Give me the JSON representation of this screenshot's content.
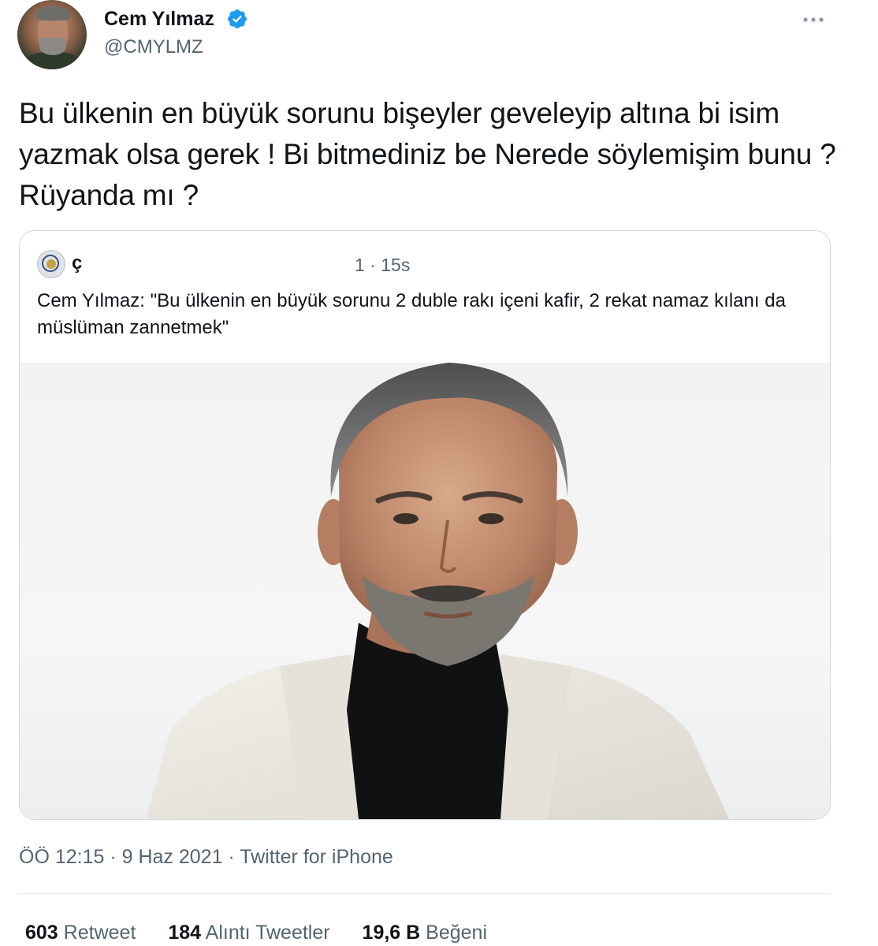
{
  "author": {
    "name": "Cem Yılmaz",
    "handle": "@CMYLMZ",
    "verified": true
  },
  "tweet": {
    "text": "Bu ülkenin en büyük sorunu bişeyler geveleyip altına bi isim yazmak olsa gerek ! Bi bitmediniz be Nerede söylemişim bunu ? Rüyanda mı ?"
  },
  "quoted_tweet": {
    "author_fragment": "ç",
    "time": "1 · 15s",
    "text": "Cem Yılmaz: \"Bu ülkenin en büyük sorunu 2 duble rakı içeni kafir, 2 rekat namaz kılanı da müslüman zannetmek\"",
    "image": "portrait-photo"
  },
  "meta": {
    "timestamp": "ÖÖ 12:15 · 9 Haz 2021 · Twitter for iPhone"
  },
  "stats": {
    "retweets_count": "603",
    "retweets_label": "Retweet",
    "quotes_count": "184",
    "quotes_label": "Alıntı Tweetler",
    "likes_count": "19,6 B",
    "likes_label": "Beğeni"
  },
  "icons": {
    "verified": "verified-badge-icon",
    "more": "more-options-icon"
  },
  "colors": {
    "text": "#0f1419",
    "secondary": "#536471",
    "verified": "#1d9bf0",
    "border": "#cfd9de"
  }
}
